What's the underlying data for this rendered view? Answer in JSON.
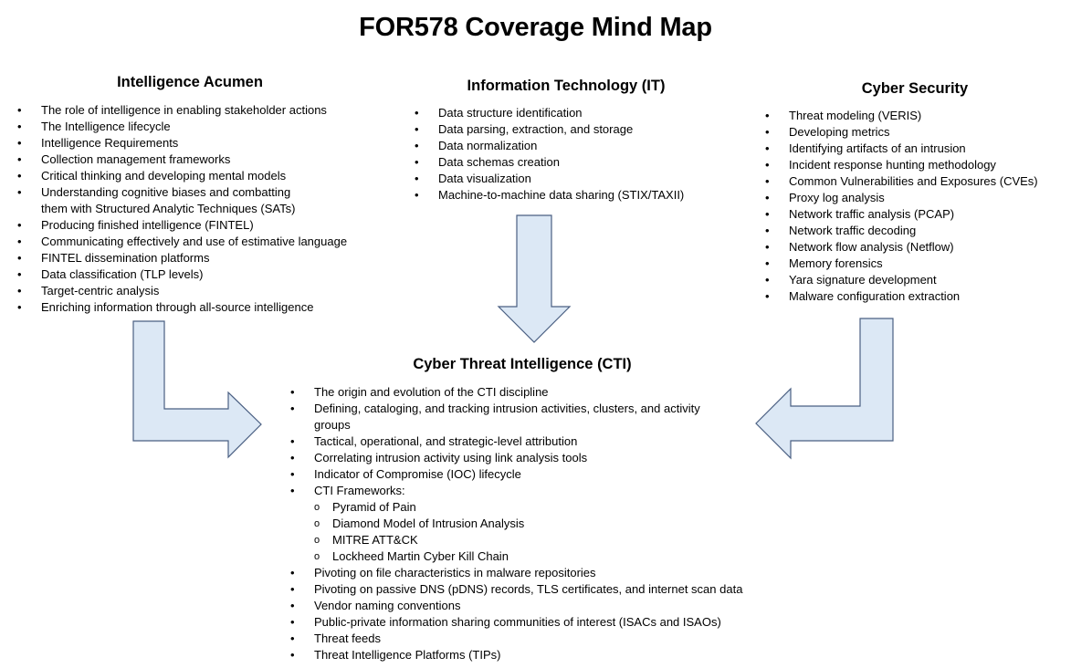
{
  "title": "FOR578 Coverage Mind Map",
  "colors": {
    "arrow_fill": "#dce8f5",
    "arrow_stroke": "#4a5f82"
  },
  "sections": {
    "intelligence_acumen": {
      "heading": "Intelligence Acumen",
      "items": [
        "The role of intelligence in enabling stakeholder actions",
        "The Intelligence lifecycle",
        "Intelligence Requirements",
        "Collection management frameworks",
        "Critical thinking and developing mental models",
        "Understanding cognitive biases and combatting",
        "them with Structured Analytic Techniques (SATs)",
        "Producing finished intelligence (FINTEL)",
        "Communicating effectively and use of estimative language",
        "FINTEL dissemination platforms",
        "Data classification (TLP levels)",
        "Target-centric analysis",
        "Enriching information through all-source intelligence"
      ]
    },
    "information_technology": {
      "heading": "Information Technology (IT)",
      "items": [
        "Data structure identification",
        "Data parsing, extraction, and storage",
        "Data normalization",
        "Data schemas creation",
        "Data visualization",
        "Machine-to-machine data sharing (STIX/TAXII)"
      ]
    },
    "cyber_security": {
      "heading": "Cyber Security",
      "items": [
        "Threat modeling (VERIS)",
        "Developing metrics",
        "Identifying artifacts of an intrusion",
        "Incident response hunting methodology",
        "Common Vulnerabilities and Exposures (CVEs)",
        "Proxy log analysis",
        "Network traffic analysis (PCAP)",
        "Network traffic decoding",
        "Network flow analysis (Netflow)",
        "Memory forensics",
        "Yara signature development",
        "Malware configuration extraction"
      ]
    },
    "cti": {
      "heading": "Cyber Threat Intelligence (CTI)",
      "items": [
        "The origin and evolution of the CTI discipline",
        "Defining, cataloging, and tracking intrusion activities, clusters, and activity",
        "groups",
        "Tactical, operational, and strategic-level attribution",
        "Correlating intrusion activity using link analysis tools",
        "Indicator of Compromise (IOC) lifecycle",
        "CTI Frameworks:",
        "Pivoting on file characteristics in malware repositories",
        "Pivoting on passive DNS (pDNS) records, TLS certificates, and internet scan data",
        "Vendor naming conventions",
        "Public-private information sharing communities of interest (ISACs and ISAOs)",
        "Threat feeds",
        "Threat Intelligence Platforms (TIPs)"
      ],
      "frameworks": [
        "Pyramid of Pain",
        "Diamond Model of Intrusion Analysis",
        "MITRE ATT&CK",
        "Lockheed Martin Cyber Kill Chain"
      ]
    }
  }
}
